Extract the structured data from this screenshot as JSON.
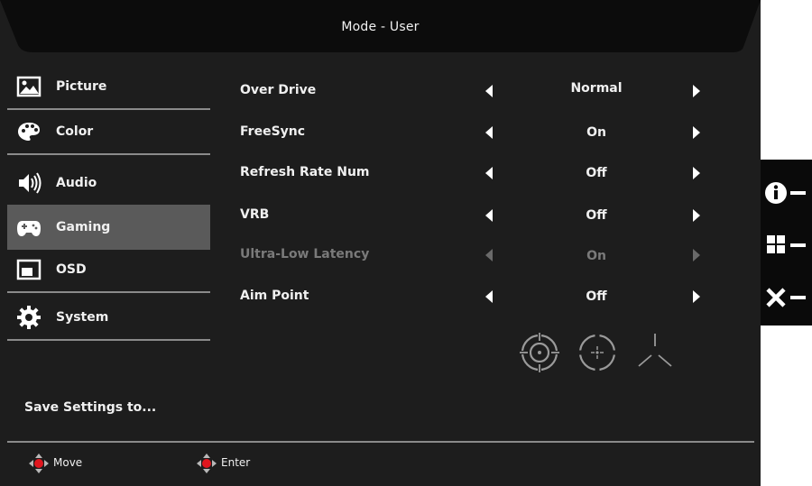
{
  "header": {
    "title": "Mode - User"
  },
  "sidebar": {
    "items": [
      {
        "label": "Picture",
        "icon": "picture-icon"
      },
      {
        "label": "Color",
        "icon": "palette-icon"
      },
      {
        "label": "Audio",
        "icon": "speaker-icon"
      },
      {
        "label": "Gaming",
        "icon": "gamepad-icon",
        "active": true
      },
      {
        "label": "OSD",
        "icon": "osd-window-icon"
      },
      {
        "label": "System",
        "icon": "gear-icon"
      }
    ],
    "save_label": "Save Settings to..."
  },
  "options": [
    {
      "name": "Over Drive",
      "value": "Normal",
      "enabled": true
    },
    {
      "name": "FreeSync",
      "value": "On",
      "enabled": true
    },
    {
      "name": "Refresh Rate Num",
      "value": "Off",
      "enabled": true
    },
    {
      "name": "VRB",
      "value": "Off",
      "enabled": true
    },
    {
      "name": "Ultra-Low Latency",
      "value": "On",
      "enabled": false
    },
    {
      "name": "Aim Point",
      "value": "Off",
      "enabled": true
    }
  ],
  "aim_point_icons": [
    "crosshair-circle-icon",
    "crosshair-dot-icon",
    "crosshair-lines-icon"
  ],
  "footer": {
    "move_label": "Move",
    "enter_label": "Enter"
  },
  "hotkeys": [
    {
      "icon": "info-icon"
    },
    {
      "icon": "input-source-icon"
    },
    {
      "icon": "close-icon"
    }
  ],
  "colors": {
    "background": "#1d1d1d",
    "header": "#0c0c0c",
    "active_item": "#5a5a5a",
    "disabled_text": "#7a7a7a",
    "dpad_center": "#e0161e"
  }
}
